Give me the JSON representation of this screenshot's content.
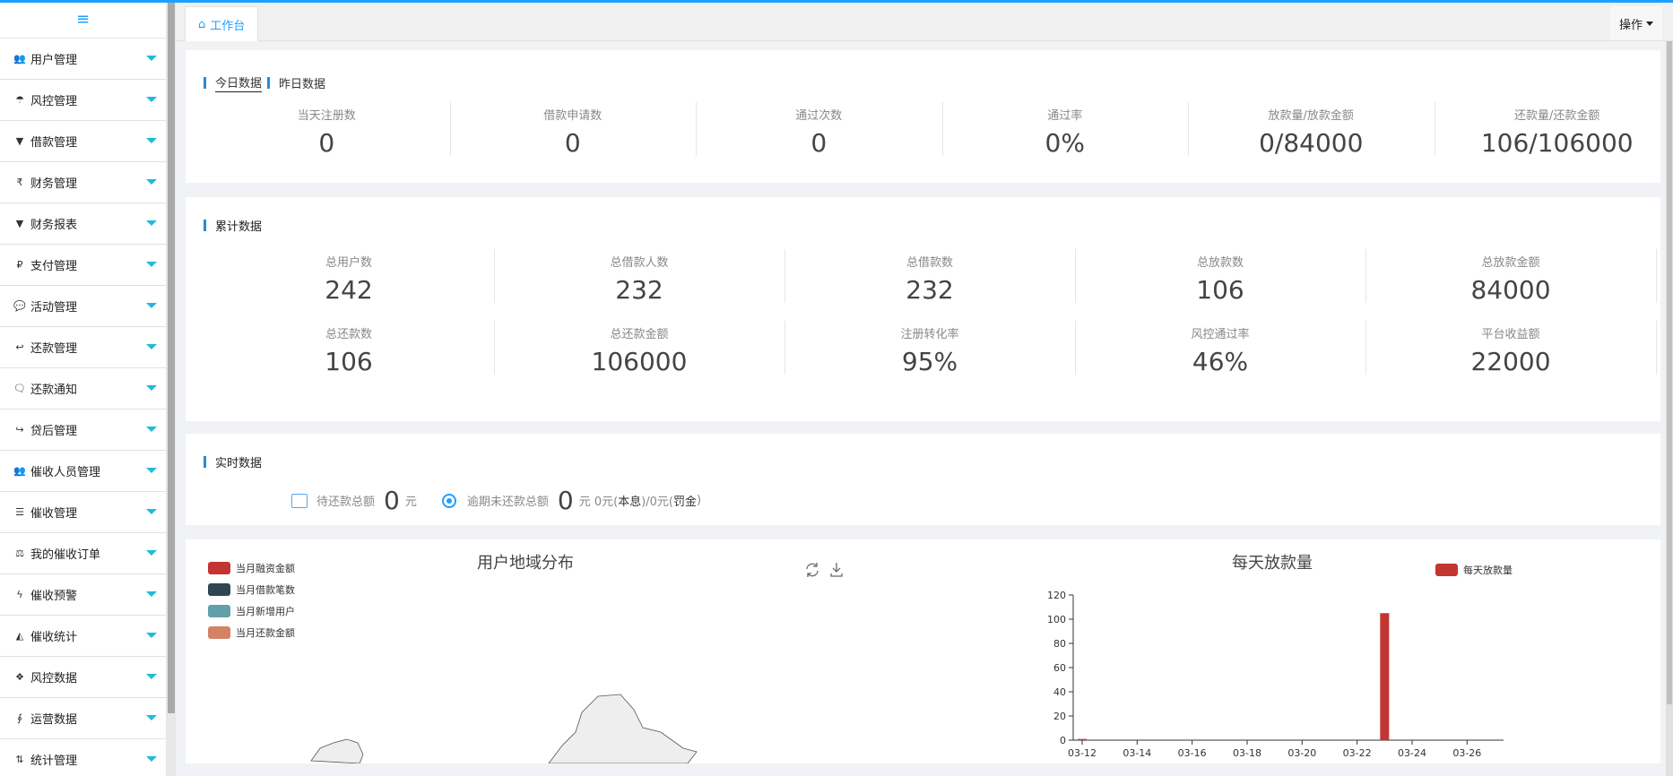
{
  "sidebar": {
    "items": [
      {
        "icon": "users-icon",
        "glyph": "👥",
        "label": "用户管理"
      },
      {
        "icon": "umbrella-icon",
        "glyph": "☂",
        "label": "风控管理"
      },
      {
        "icon": "filter-icon",
        "glyph": "▼",
        "label": "借款管理"
      },
      {
        "icon": "rupee-icon",
        "glyph": "₹",
        "label": "财务管理"
      },
      {
        "icon": "filter-icon",
        "glyph": "▼",
        "label": "财务报表"
      },
      {
        "icon": "paypal-icon",
        "glyph": "₽",
        "label": "支付管理"
      },
      {
        "icon": "comment-icon",
        "glyph": "💬",
        "label": "活动管理"
      },
      {
        "icon": "reply-icon",
        "glyph": "↩",
        "label": "还款管理"
      },
      {
        "icon": "comments-icon",
        "glyph": "🗨",
        "label": "还款通知"
      },
      {
        "icon": "share-icon",
        "glyph": "↪",
        "label": "贷后管理"
      },
      {
        "icon": "users-icon",
        "glyph": "👥",
        "label": "催收人员管理"
      },
      {
        "icon": "list-icon",
        "glyph": "☰",
        "label": "催收管理"
      },
      {
        "icon": "balance-icon",
        "glyph": "⚖",
        "label": "我的催收订单"
      },
      {
        "icon": "bolt-icon",
        "glyph": "ϟ",
        "label": "催收预警"
      },
      {
        "icon": "area-chart-icon",
        "glyph": "◭",
        "label": "催收统计"
      },
      {
        "icon": "cubes-icon",
        "glyph": "❖",
        "label": "风控数据"
      },
      {
        "icon": "fingerprint-icon",
        "glyph": "∮",
        "label": "运营数据"
      },
      {
        "icon": "sort-icon",
        "glyph": "⇅",
        "label": "统计管理"
      }
    ]
  },
  "tabs": {
    "home_label": "工作台",
    "ops_label": "操作"
  },
  "today": {
    "tab_today": "今日数据",
    "tab_yesterday": "昨日数据",
    "stats": [
      {
        "label": "当天注册数",
        "value": "0"
      },
      {
        "label": "借款申请数",
        "value": "0"
      },
      {
        "label": "通过次数",
        "value": "0"
      },
      {
        "label": "通过率",
        "value": "0%"
      },
      {
        "label": "放款量/放款金额",
        "value": "0/84000"
      },
      {
        "label": "还款量/还款金额",
        "value": "106/106000"
      }
    ]
  },
  "cumulative": {
    "title": "累计数据",
    "row1": [
      {
        "label": "总用户数",
        "value": "242"
      },
      {
        "label": "总借款人数",
        "value": "232"
      },
      {
        "label": "总借款数",
        "value": "232"
      },
      {
        "label": "总放款数",
        "value": "106"
      },
      {
        "label": "总放款金额",
        "value": "84000"
      }
    ],
    "row2": [
      {
        "label": "总还款数",
        "value": "106"
      },
      {
        "label": "总还款金额",
        "value": "106000"
      },
      {
        "label": "注册转化率",
        "value": "95%"
      },
      {
        "label": "风控通过率",
        "value": "46%"
      },
      {
        "label": "平台收益额",
        "value": "22000"
      }
    ]
  },
  "realtime": {
    "title": "实时数据",
    "pending_label": "待还款总额",
    "pending_value": "0",
    "pending_unit": "元",
    "overdue_label": "逾期未还款总额",
    "overdue_value": "0",
    "overdue_unit": "元 0元(",
    "overdue_principal": "本息",
    "overdue_mid": ")/0元(",
    "overdue_penalty": "罚金",
    "overdue_end": ")"
  },
  "map_panel": {
    "title": "用户地域分布",
    "legend": [
      {
        "label": "当月融资金额",
        "color": "#c23531"
      },
      {
        "label": "当月借款笔数",
        "color": "#2f4554"
      },
      {
        "label": "当月新增用户",
        "color": "#61a0a8"
      },
      {
        "label": "当月还款金额",
        "color": "#d48265"
      }
    ],
    "tools": {
      "refresh_icon": "refresh-icon",
      "download_icon": "download-icon"
    }
  },
  "chart_data": {
    "type": "bar",
    "title": "每天放款量",
    "legend": [
      "每天放款量"
    ],
    "color": "#c23531",
    "x_ticks": [
      "03-12",
      "03-14",
      "03-16",
      "03-18",
      "03-20",
      "03-22",
      "03-24",
      "03-26"
    ],
    "x": [
      "03-12",
      "03-13",
      "03-14",
      "03-15",
      "03-16",
      "03-17",
      "03-18",
      "03-19",
      "03-20",
      "03-21",
      "03-22",
      "03-23",
      "03-24",
      "03-25",
      "03-26",
      "03-27"
    ],
    "values": [
      1,
      0,
      0,
      0,
      0,
      0,
      0,
      0,
      0,
      0,
      0,
      105,
      0,
      0,
      0,
      0
    ],
    "ylim": [
      0,
      120
    ],
    "y_ticks": [
      0,
      20,
      40,
      60,
      80,
      100,
      120
    ]
  }
}
